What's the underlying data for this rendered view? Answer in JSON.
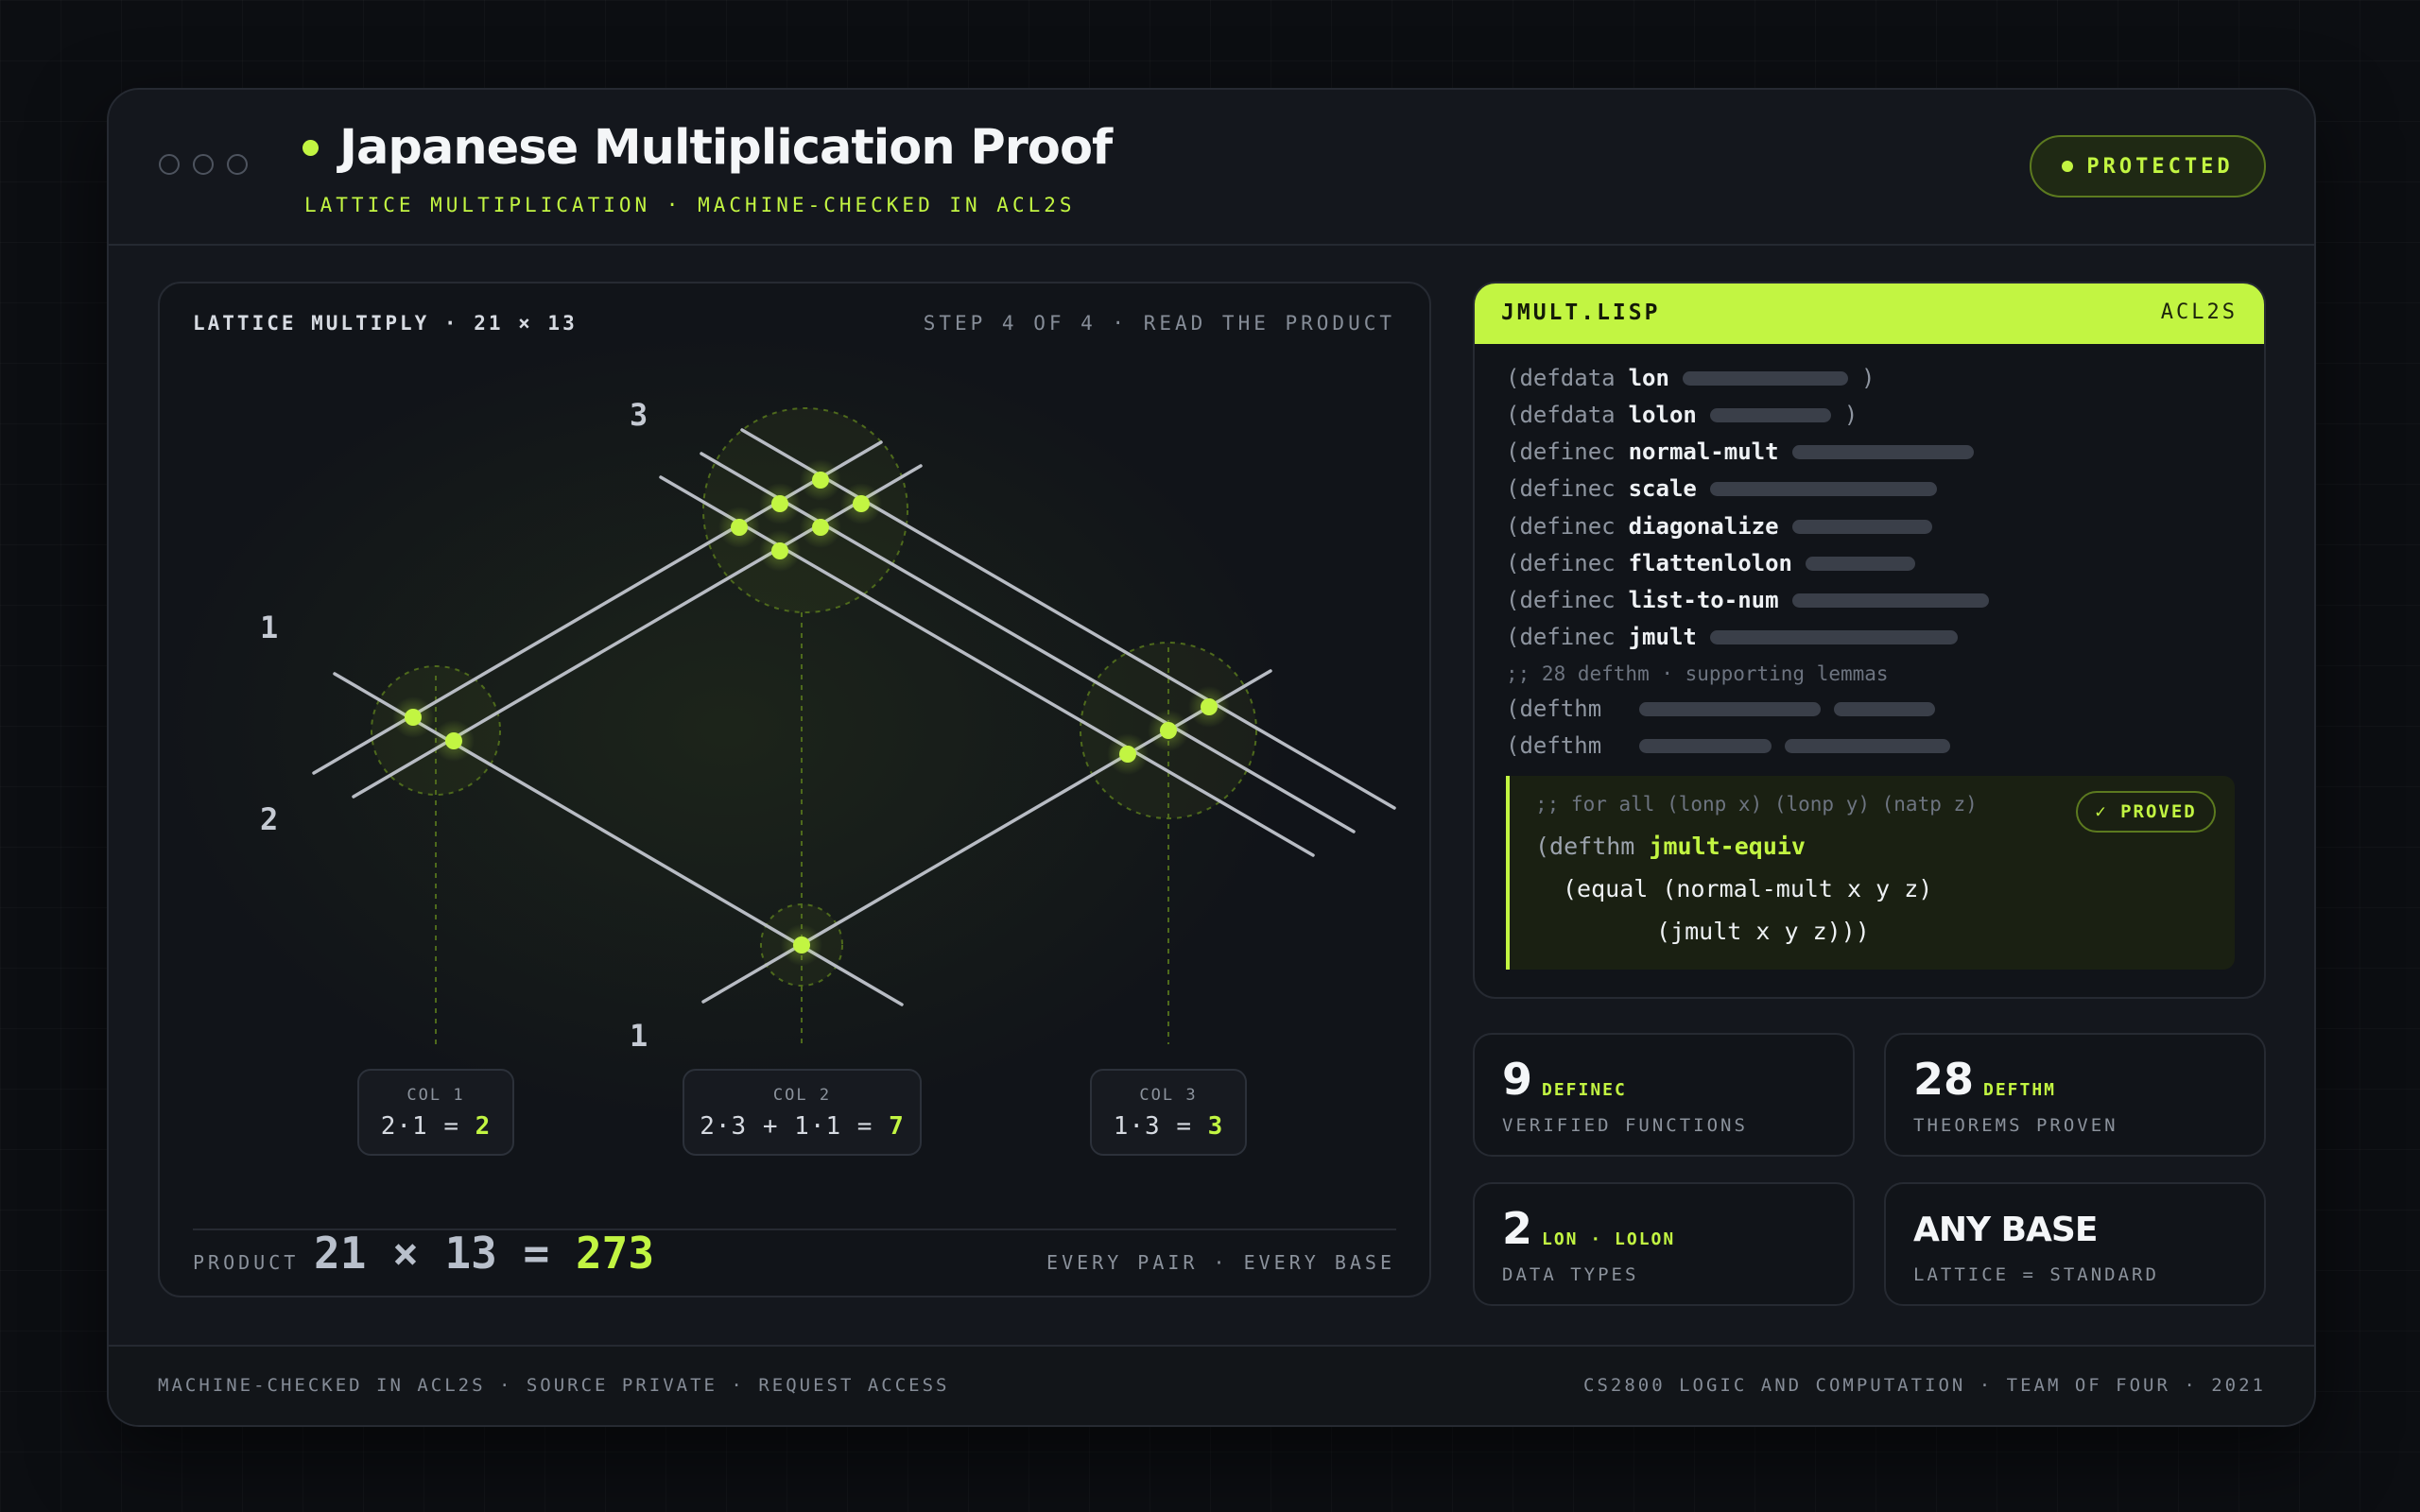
{
  "window": {
    "title": "Japanese Multiplication Proof",
    "subtitle": "LATTICE MULTIPLICATION · MACHINE-CHECKED IN ACL2S",
    "badge": "PROTECTED"
  },
  "lattice": {
    "heading": "LATTICE MULTIPLY · 21 × 13",
    "step": "STEP 4 OF 4 · READ THE PRODUCT",
    "digit_labels": [
      "3",
      "1",
      "2",
      "1"
    ],
    "columns": [
      {
        "label": "COL 1",
        "expr": "2·1 = ",
        "value": "2"
      },
      {
        "label": "COL 2",
        "expr": "2·3 + 1·1 = ",
        "value": "7"
      },
      {
        "label": "COL 3",
        "expr": "1·3 = ",
        "value": "3"
      }
    ],
    "product_label": "PRODUCT",
    "product_expr": "21 × 13 = ",
    "product_value": "273",
    "footnote": "EVERY PAIR · EVERY BASE",
    "accent": "#c2f542"
  },
  "code": {
    "filename": "JMULT.LISP",
    "lang": "ACL2S",
    "lines": [
      {
        "kw": "(defdata",
        "name": "lon",
        "close": ")"
      },
      {
        "kw": "(defdata",
        "name": "lolon",
        "close": ")"
      },
      {
        "kw": "(definec",
        "name": "normal-mult"
      },
      {
        "kw": "(definec",
        "name": "scale"
      },
      {
        "kw": "(definec",
        "name": "diagonalize"
      },
      {
        "kw": "(definec",
        "name": "flattenlolon"
      },
      {
        "kw": "(definec",
        "name": "list-to-num"
      },
      {
        "kw": "(definec",
        "name": "jmult"
      }
    ],
    "comment": ";; 28 defthm · supporting lemmas",
    "defthm_lines": [
      "(defthm",
      "(defthm"
    ],
    "proof": {
      "comment": ";; for all (lonp x) (lonp y) (natp z)",
      "kw": "(defthm ",
      "name": "jmult-equiv",
      "line2": "(equal (normal-mult x y z)",
      "line3": "(jmult x y z)))",
      "badge": "✓ PROVED"
    }
  },
  "stats": [
    {
      "big": "9",
      "tag": "DEFINEC",
      "label": "VERIFIED FUNCTIONS"
    },
    {
      "big": "28",
      "tag": "DEFTHM",
      "label": "THEOREMS PROVEN"
    },
    {
      "big": "2",
      "tag": "LON · LOLON",
      "label": "DATA TYPES"
    },
    {
      "big": "ANY BASE",
      "label": "LATTICE = STANDARD"
    }
  ],
  "footer": {
    "left": "MACHINE-CHECKED IN ACL2S · SOURCE PRIVATE · REQUEST ACCESS",
    "right": "CS2800 LOGIC AND COMPUTATION · TEAM OF FOUR · 2021"
  }
}
